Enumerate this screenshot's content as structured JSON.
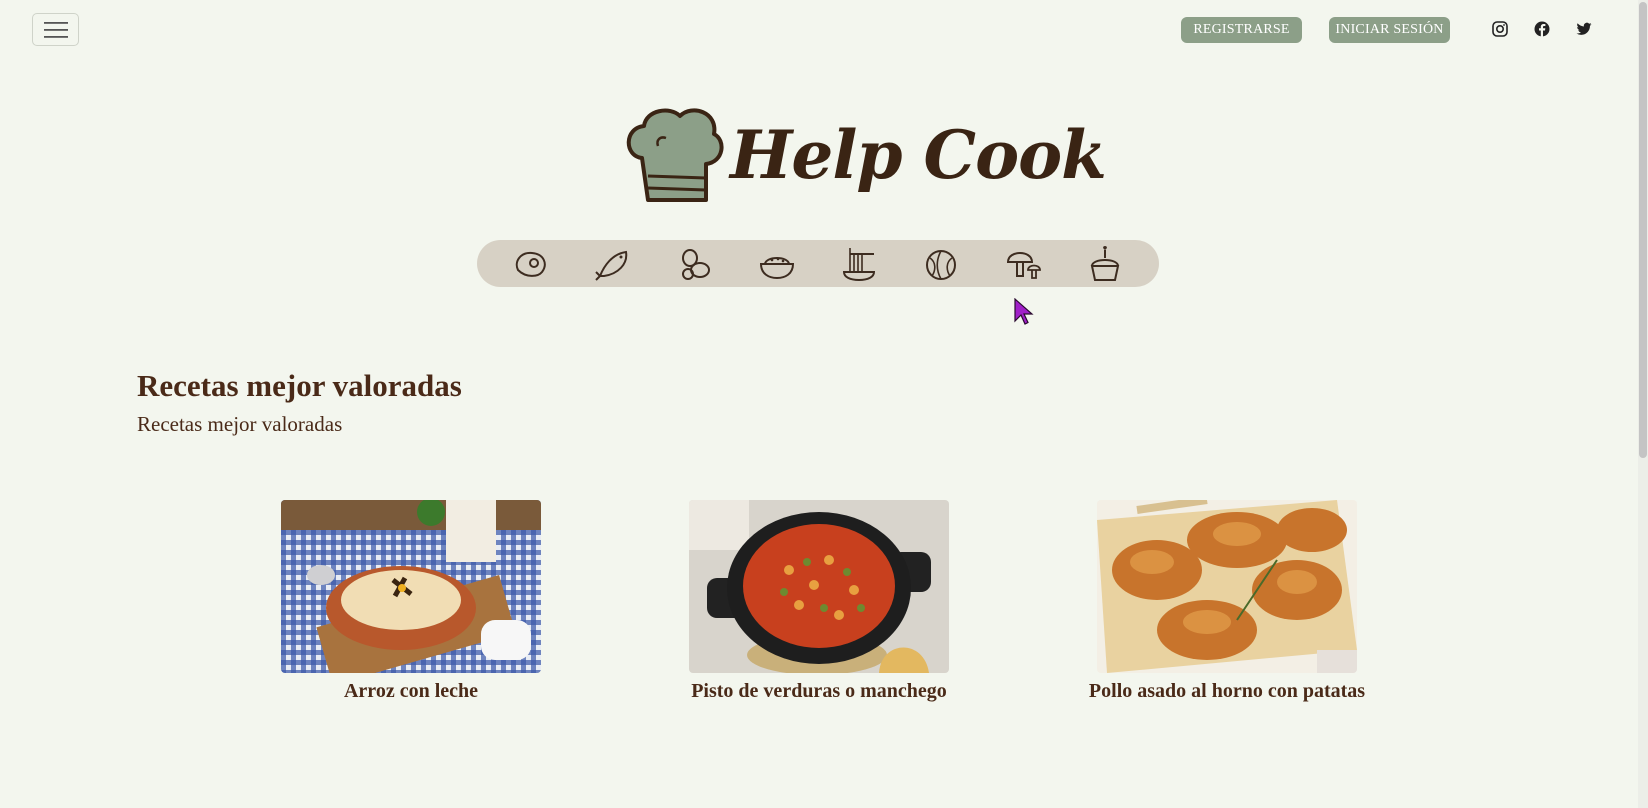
{
  "header": {
    "menu_icon": "hamburger-icon",
    "register_label": "REGISTRARSE",
    "login_label": "INICIAR SESIÓN",
    "social": [
      "instagram-icon",
      "facebook-icon",
      "twitter-icon"
    ]
  },
  "logo": {
    "text": "Help Cook",
    "icon": "chef-hat-icon"
  },
  "categories": [
    "meat-icon",
    "fish-icon",
    "legumes-icon",
    "rice-icon",
    "pasta-icon",
    "vegetables-icon",
    "mushroom-icon",
    "dessert-icon"
  ],
  "section": {
    "title": "Recetas mejor valoradas",
    "subtitle": "Recetas mejor valoradas"
  },
  "recipes": [
    {
      "title": "Arroz con leche"
    },
    {
      "title": "Pisto de verduras o manchego"
    },
    {
      "title": "Pollo asado al horno con patatas"
    }
  ],
  "colors": {
    "background": "#f3f6ee",
    "accent": "#8c9f88",
    "text": "#4a2a18",
    "category_bar": "#d7d1c5"
  }
}
